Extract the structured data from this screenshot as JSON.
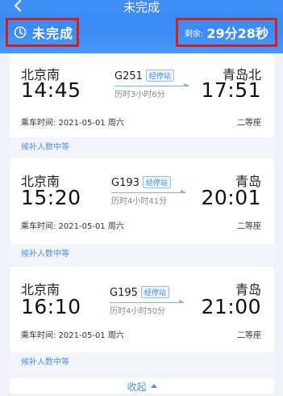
{
  "header": {
    "title": "未完成",
    "status": "未完成",
    "remain_label": "剩余:",
    "remain_value": "29分28秒"
  },
  "trips": [
    {
      "from": "北京南",
      "to": "青岛北",
      "train": "G251",
      "stop_label": "经停站",
      "dep": "14:45",
      "arr": "17:51",
      "duration": "历时3小时6分",
      "date": "乘车时间: 2021-05-01 周六",
      "seat": "二等座",
      "waitlist": "候补人数中等"
    },
    {
      "from": "北京南",
      "to": "青岛",
      "train": "G193",
      "stop_label": "经停站",
      "dep": "15:20",
      "arr": "20:01",
      "duration": "历时4小时41分",
      "date": "乘车时间: 2021-05-01 周六",
      "seat": "二等座",
      "waitlist": "候补人数中等"
    },
    {
      "from": "北京南",
      "to": "青岛",
      "train": "G195",
      "stop_label": "经停站",
      "dep": "16:10",
      "arr": "21:00",
      "duration": "历时4小时50分",
      "date": "乘车时间: 2021-05-01 周六",
      "seat": "二等座",
      "waitlist": "候补人数中等"
    }
  ],
  "collapse_label": "收起",
  "colors": {
    "accent": "#3b8bf4",
    "highlight_border": "#d51f1f"
  },
  "icons": {
    "back": "chevron-left-icon",
    "status": "clock-icon",
    "collapse": "triangle-up-icon"
  }
}
